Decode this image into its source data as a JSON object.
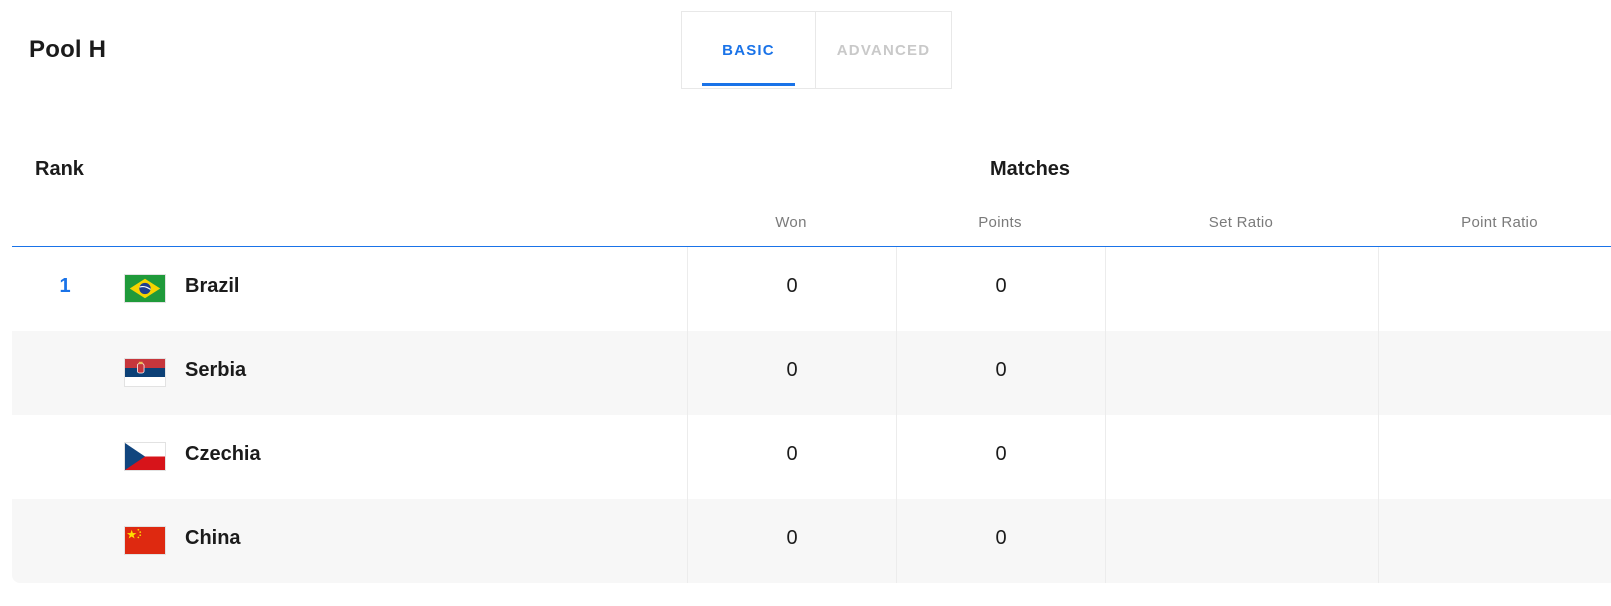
{
  "pool": {
    "title": "Pool H"
  },
  "tabs": [
    {
      "label": "BASIC",
      "active": true
    },
    {
      "label": "ADVANCED",
      "active": false
    }
  ],
  "table": {
    "rank_header": "Rank",
    "group_header": "Matches",
    "columns": [
      "Won",
      "Points",
      "Set Ratio",
      "Point Ratio"
    ],
    "rows": [
      {
        "rank": "1",
        "team": "Brazil",
        "flag": "brazil-flag-icon",
        "won": "0",
        "points": "0",
        "set_ratio": "",
        "point_ratio": ""
      },
      {
        "rank": "",
        "team": "Serbia",
        "flag": "serbia-flag-icon",
        "won": "0",
        "points": "0",
        "set_ratio": "",
        "point_ratio": ""
      },
      {
        "rank": "",
        "team": "Czechia",
        "flag": "czechia-flag-icon",
        "won": "0",
        "points": "0",
        "set_ratio": "",
        "point_ratio": ""
      },
      {
        "rank": "",
        "team": "China",
        "flag": "china-flag-icon",
        "won": "0",
        "points": "0",
        "set_ratio": "",
        "point_ratio": ""
      }
    ]
  },
  "colors": {
    "accent": "#1a73e8",
    "inactive_tab": "#c9c9c9",
    "row_alt": "#f7f7f7"
  }
}
